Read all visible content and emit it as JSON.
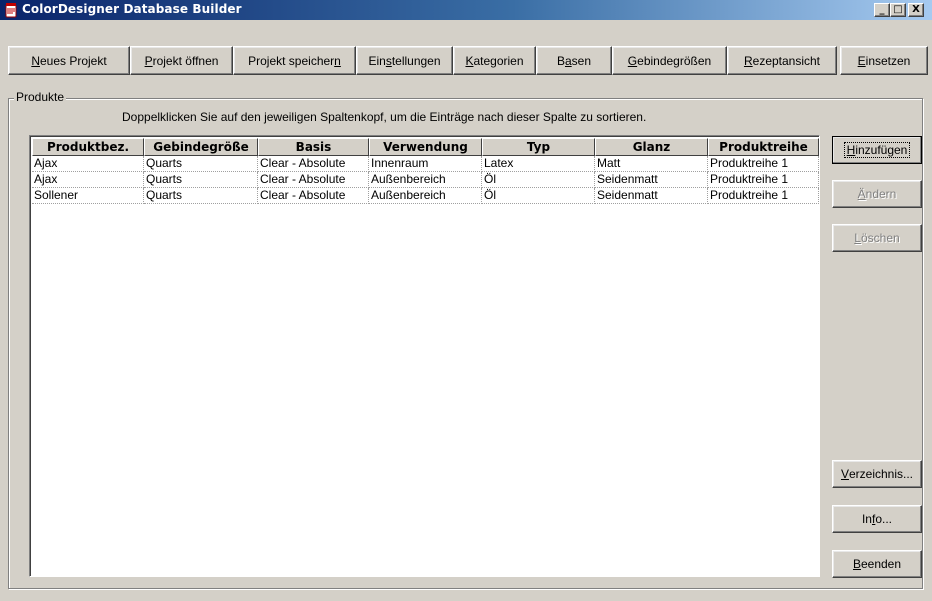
{
  "window": {
    "title": "ColorDesigner Database Builder",
    "controls": {
      "minimize": "_",
      "maximize": "□",
      "close": "X"
    }
  },
  "toolbar": {
    "buttons": [
      {
        "pre": "",
        "key": "N",
        "post": "eues Projekt"
      },
      {
        "pre": "",
        "key": "P",
        "post": "rojekt öffnen"
      },
      {
        "pre": "Projekt speicher",
        "key": "n",
        "post": ""
      },
      {
        "pre": "Ein",
        "key": "s",
        "post": "tellungen"
      },
      {
        "pre": "",
        "key": "K",
        "post": "ategorien"
      },
      {
        "pre": "B",
        "key": "a",
        "post": "sen"
      },
      {
        "pre": "",
        "key": "G",
        "post": "ebindegrößen"
      },
      {
        "pre": "",
        "key": "R",
        "post": "ezeptansicht"
      },
      {
        "pre": "",
        "key": "E",
        "post": "insetzen"
      }
    ]
  },
  "products": {
    "group_label": "Produkte",
    "hint": "Doppelklicken Sie auf den jeweiligen Spaltenkopf, um die Einträge nach dieser Spalte zu sortieren.",
    "columns": [
      "Produktbez.",
      "Gebindegröße",
      "Basis",
      "Verwendung",
      "Typ",
      "Glanz",
      "Produktreihe"
    ],
    "rows": [
      [
        "Ajax",
        "Quarts",
        "Clear - Absolute",
        "Innenraum",
        "Latex",
        "Matt",
        "Produktreihe 1"
      ],
      [
        "Ajax",
        "Quarts",
        "Clear - Absolute",
        "Außenbereich",
        "Öl",
        "Seidenmatt",
        "Produktreihe 1"
      ],
      [
        "Sollener",
        "Quarts",
        "Clear - Absolute",
        "Außenbereich",
        "Öl",
        "Seidenmatt",
        "Produktreihe 1"
      ]
    ]
  },
  "side_buttons": {
    "add": {
      "pre": "",
      "key": "H",
      "post": "inzufügen"
    },
    "change": {
      "pre": "",
      "key": "Ä",
      "post": "ndern"
    },
    "delete": {
      "pre": "",
      "key": "L",
      "post": "öschen"
    },
    "directory": {
      "pre": "",
      "key": "V",
      "post": "erzeichnis..."
    },
    "info": {
      "pre": "In",
      "key": "f",
      "post": "o..."
    },
    "quit": {
      "pre": "",
      "key": "B",
      "post": "eenden"
    }
  },
  "colors": {
    "titlebar_start": "#0a246a",
    "titlebar_end": "#a6caf0",
    "face": "#d4d0c8"
  },
  "icons": {
    "app": "paint-bucket-icon"
  }
}
